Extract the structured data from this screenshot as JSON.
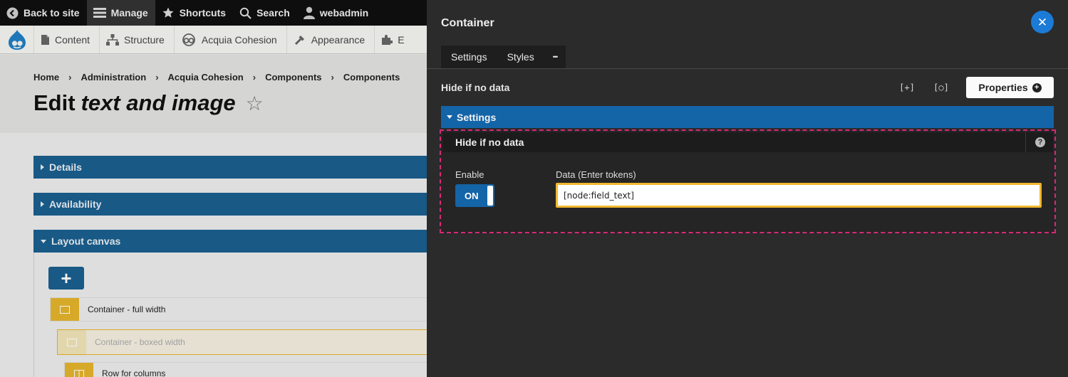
{
  "toolbar": {
    "back_to_site": "Back to site",
    "manage": "Manage",
    "shortcuts": "Shortcuts",
    "search": "Search",
    "user": "webadmin"
  },
  "tray": {
    "items": [
      "Content",
      "Structure",
      "Acquia Cohesion",
      "Appearance",
      "E"
    ]
  },
  "breadcrumb": [
    "Home",
    "Administration",
    "Acquia Cohesion",
    "Components",
    "Components"
  ],
  "breadcrumb_separator": "›",
  "page_title": {
    "prefix": "Edit",
    "emphasis": "text and image",
    "star": "☆"
  },
  "sections": {
    "details": "Details",
    "availability": "Availability",
    "layout_canvas": "Layout canvas"
  },
  "canvas": {
    "add_button": "+",
    "components": [
      {
        "label": "Container - full width"
      },
      {
        "label": "Container - boxed width"
      },
      {
        "label": "Row for columns"
      }
    ]
  },
  "panel": {
    "title": "Container",
    "close": "✕",
    "tabs": [
      "Settings",
      "Styles",
      "•••"
    ],
    "section_label": "Hide if no data",
    "icon_buttons": [
      "[+]",
      "[○]"
    ],
    "properties_button": "Properties",
    "properties_plus": "+",
    "settings_header": "Settings",
    "form": {
      "title": "Hide if no data",
      "help": "?",
      "enable_label": "Enable",
      "toggle_state": "ON",
      "data_label": "Data (Enter tokens)",
      "data_value": "[node:field_text]"
    }
  },
  "colors": {
    "accent_blue": "#1464a8",
    "close_blue": "#1b7bd6",
    "focus_border": "#f0b830",
    "dashed_pink": "#d6297a",
    "component_gold": "#e5b42c"
  }
}
